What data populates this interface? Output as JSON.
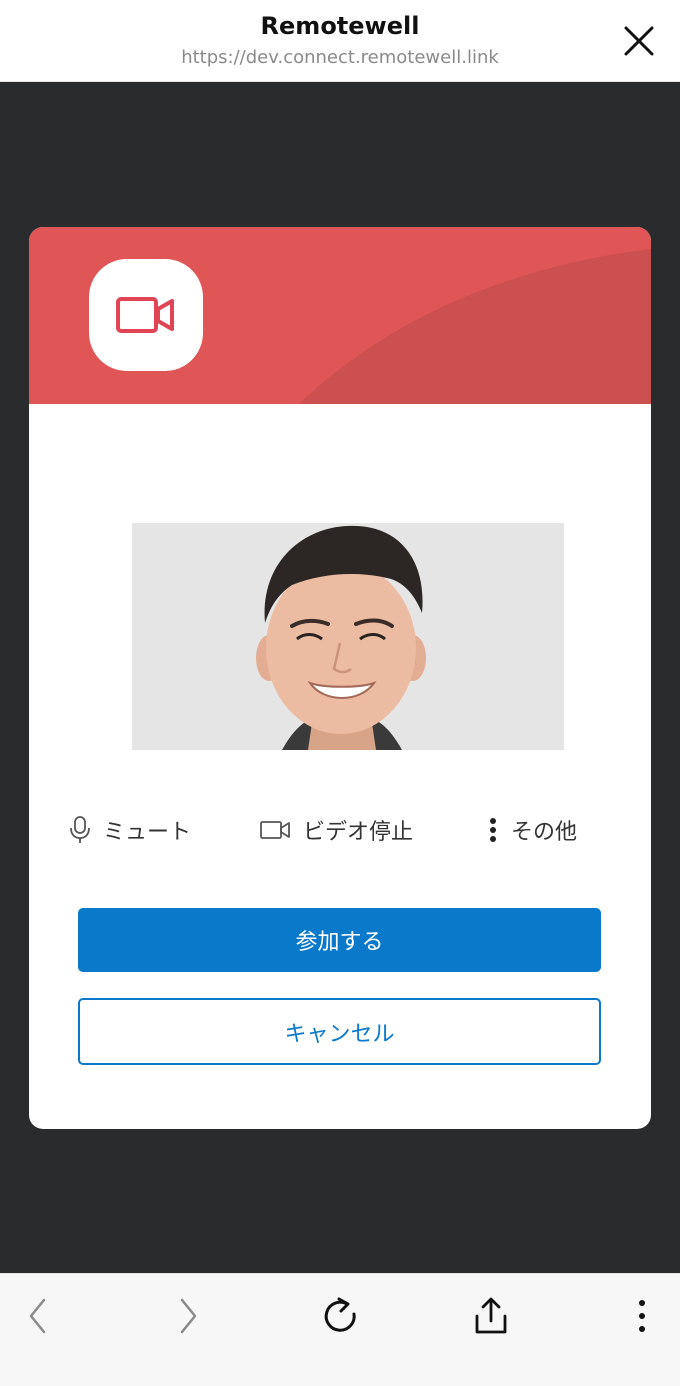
{
  "browser": {
    "title": "Remotewell",
    "url": "https://dev.connect.remotewell.link"
  },
  "dialog": {
    "accent_color": "#e05555",
    "app_icon": "video-camera-icon",
    "controls": {
      "mute_label": "ミュート",
      "mute_icon": "microphone-icon",
      "video_label": "ビデオ停止",
      "video_icon": "video-camera-icon",
      "more_label": "その他",
      "more_icon": "vertical-dots-icon"
    },
    "join_label": "参加する",
    "cancel_label": "キャンセル",
    "primary_color": "#0a79c9"
  },
  "toolbar": {
    "back_icon": "chevron-left-icon",
    "forward_icon": "chevron-right-icon",
    "reload_icon": "reload-icon",
    "share_icon": "share-icon",
    "menu_icon": "vertical-dots-icon"
  }
}
